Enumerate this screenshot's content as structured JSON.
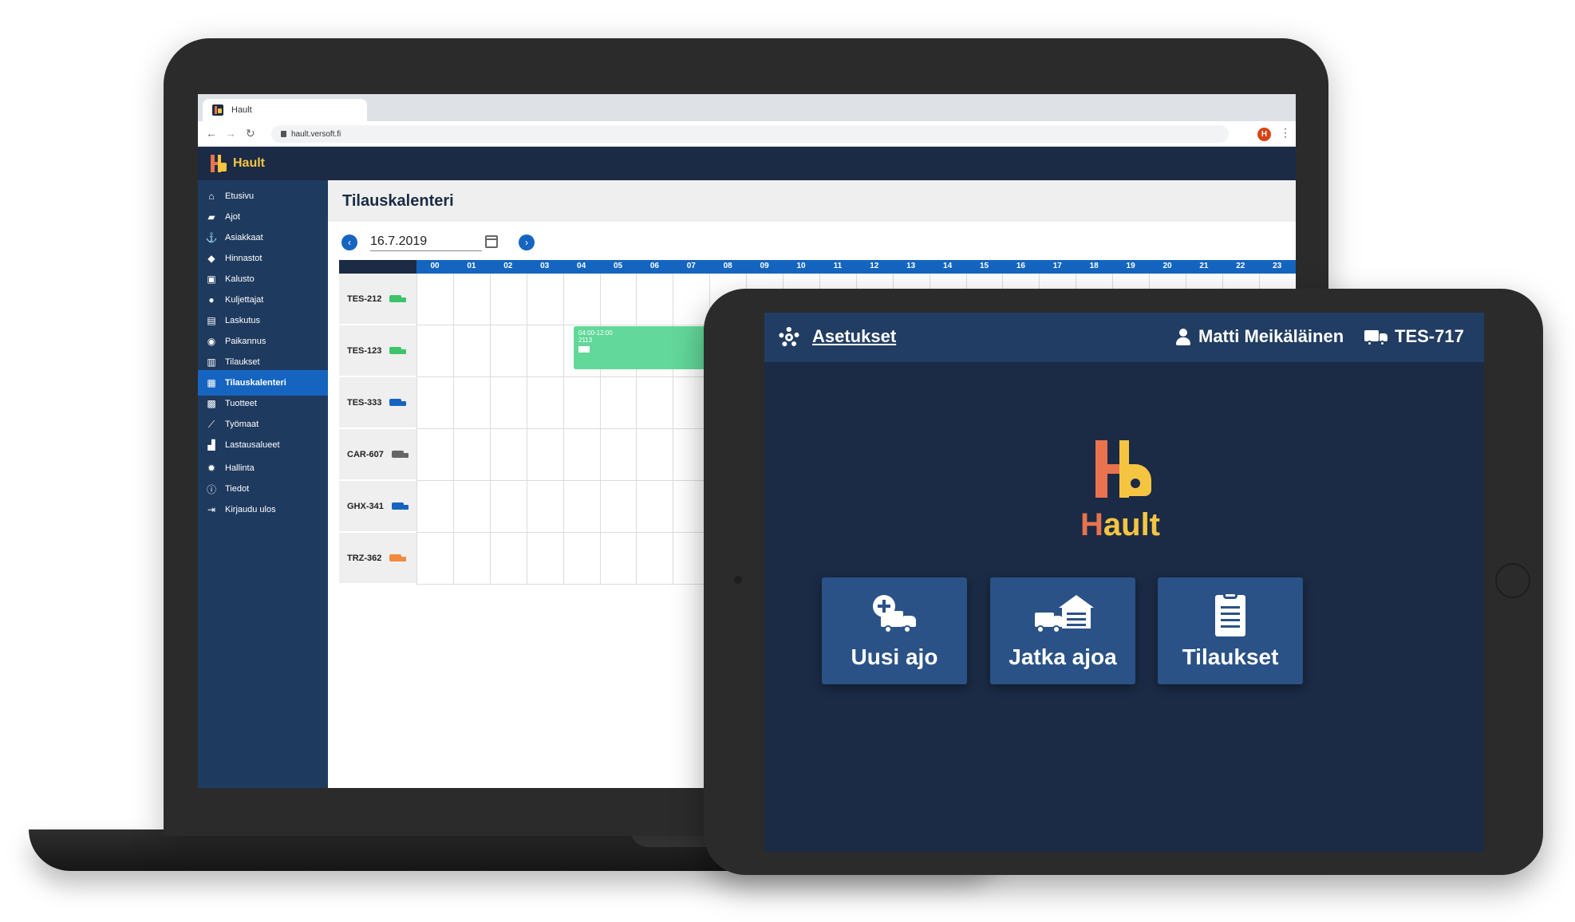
{
  "browser": {
    "tab_title": "Hault",
    "url": "hault.versoft.fi",
    "profile_initial": "H"
  },
  "app": {
    "name": "Hault",
    "page_title": "Tilauskalenteri",
    "date": "16.7.2019"
  },
  "sidebar": {
    "items": [
      {
        "label": "Etusivu",
        "icon": "home-icon"
      },
      {
        "label": "Ajot",
        "icon": "truck-icon"
      },
      {
        "label": "Asiakkaat",
        "icon": "anchor-icon"
      },
      {
        "label": "Hinnastot",
        "icon": "tag-icon"
      },
      {
        "label": "Kalusto",
        "icon": "truck-loading-icon"
      },
      {
        "label": "Kuljettajat",
        "icon": "person-icon"
      },
      {
        "label": "Laskutus",
        "icon": "invoice-icon"
      },
      {
        "label": "Paikannus",
        "icon": "map-pin-icon"
      },
      {
        "label": "Tilaukset",
        "icon": "clipboard-icon"
      },
      {
        "label": "Tilauskalenteri",
        "icon": "calendar-icon",
        "active": true
      },
      {
        "label": "Tuotteet",
        "icon": "boxes-icon"
      },
      {
        "label": "Työmaat",
        "icon": "excavator-icon"
      },
      {
        "label": "Lastausalueet",
        "icon": "warehouse-icon"
      },
      {
        "label": "Hallinta",
        "icon": "gear-icon"
      },
      {
        "label": "Tiedot",
        "icon": "info-icon"
      },
      {
        "label": "Kirjaudu ulos",
        "icon": "logout-icon"
      }
    ]
  },
  "calendar": {
    "hours": [
      "00",
      "01",
      "02",
      "03",
      "04",
      "05",
      "06",
      "07",
      "08",
      "09",
      "10",
      "11",
      "12",
      "13",
      "14",
      "15",
      "16",
      "17",
      "18",
      "19",
      "20",
      "21",
      "22",
      "23"
    ],
    "vehicles": [
      {
        "plate": "TES-212",
        "icon": "truck-fast-icon",
        "color": "#3cc46b"
      },
      {
        "plate": "TES-123",
        "icon": "truck-fast-icon",
        "color": "#3cc46b"
      },
      {
        "plate": "TES-333",
        "icon": "truck-icon",
        "color": "#1565c0"
      },
      {
        "plate": "CAR-607",
        "icon": "truck-off-icon",
        "color": "#666666"
      },
      {
        "plate": "GHX-341",
        "icon": "truck-sync-icon",
        "color": "#1565c0"
      },
      {
        "plate": "TRZ-362",
        "icon": "truck-loading-icon",
        "color": "#f08a3e"
      }
    ],
    "booking": {
      "time": "04:00-12:00",
      "id": "2113",
      "color": "#62d89a"
    }
  },
  "tablet": {
    "settings_label": "Asetukset",
    "user_name": "Matti Meikäläinen",
    "vehicle_id": "TES-717",
    "logo_text_h": "H",
    "logo_text_rest": "ault",
    "tiles": [
      {
        "label": "Uusi ajo",
        "icon": "new-trip-icon"
      },
      {
        "label": "Jatka ajoa",
        "icon": "continue-trip-icon"
      },
      {
        "label": "Tilaukset",
        "icon": "clipboard-icon"
      }
    ]
  },
  "colors": {
    "navy": "#1b2b45",
    "blue": "#1565c0",
    "orange": "#e8734e",
    "yellow": "#f5c542",
    "tile": "#2a5286"
  }
}
